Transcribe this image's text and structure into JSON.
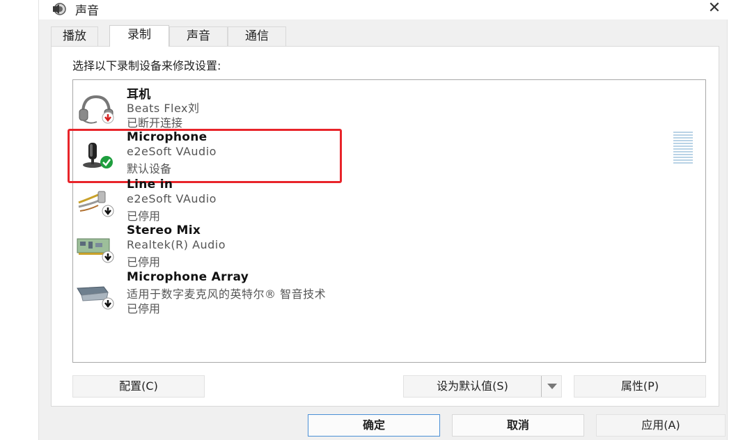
{
  "window": {
    "title": "声音",
    "close_glyph": "✕"
  },
  "tabs": [
    {
      "label": "播放",
      "active": false
    },
    {
      "label": "录制",
      "active": true
    },
    {
      "label": "声音",
      "active": false
    },
    {
      "label": "通信",
      "active": false
    }
  ],
  "instruction": "选择以下录制设备来修改设置:",
  "devices": [
    {
      "name": "耳机",
      "driver": "Beats Flex刘",
      "status": "已断开连接",
      "icon": "headset-icon",
      "badge": "disconnected-red-arrow"
    },
    {
      "name": "Microphone",
      "driver": "e2eSoft VAudio",
      "status": "默认设备",
      "icon": "microphone-icon",
      "badge": "default-green-check",
      "selected": true
    },
    {
      "name": "Line in",
      "driver": "e2eSoft VAudio",
      "status": "已停用",
      "icon": "line-in-cable-icon",
      "badge": "disabled-down-arrow"
    },
    {
      "name": "Stereo Mix",
      "driver": "Realtek(R) Audio",
      "status": "已停用",
      "icon": "sound-card-icon",
      "badge": "disabled-down-arrow"
    },
    {
      "name": "Microphone Array",
      "driver": "适用于数字麦克风的英特尔® 智音技术",
      "status": "已停用",
      "icon": "microphone-array-icon",
      "badge": "disabled-down-arrow"
    }
  ],
  "buttons": {
    "configure": "配置(C)",
    "set_default": "设为默认值(S)",
    "properties": "属性(P)",
    "ok": "确定",
    "cancel": "取消",
    "apply": "应用(A)"
  },
  "colors": {
    "highlight": "#e8242a",
    "focus_border": "#4a8fd6",
    "default_check": "#1e9e3e",
    "level_meter": "#b9d3e6"
  }
}
